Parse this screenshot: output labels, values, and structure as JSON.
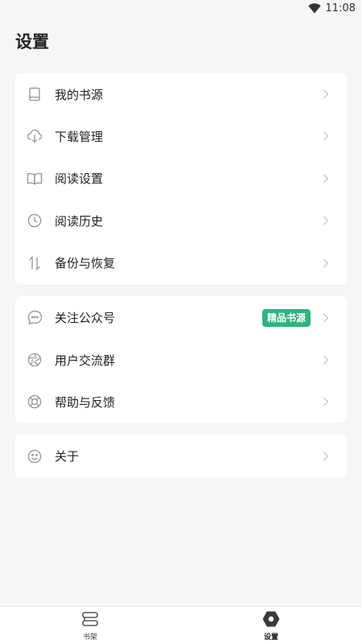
{
  "status_bar": {
    "time": "11:08"
  },
  "page": {
    "title": "设置"
  },
  "group1": [
    {
      "label": "我的书源",
      "icon": "book-icon"
    },
    {
      "label": "下载管理",
      "icon": "cloud-download-icon"
    },
    {
      "label": "阅读设置",
      "icon": "open-book-icon"
    },
    {
      "label": "阅读历史",
      "icon": "clock-icon"
    },
    {
      "label": "备份与恢复",
      "icon": "swap-vertical-icon"
    }
  ],
  "group2": [
    {
      "label": "关注公众号",
      "icon": "chat-bubble-icon",
      "badge": "精品书源"
    },
    {
      "label": "用户交流群",
      "icon": "aperture-icon"
    },
    {
      "label": "帮助与反馈",
      "icon": "lifebuoy-icon"
    }
  ],
  "group3": [
    {
      "label": "关于",
      "icon": "smiley-icon"
    }
  ],
  "bottom_nav": [
    {
      "label": "书架",
      "icon": "bookshelf-icon",
      "active": false
    },
    {
      "label": "设置",
      "icon": "settings-hex-icon",
      "active": true
    }
  ],
  "colors": {
    "accent": "#2db47c",
    "icon_gray": "#9a9a9a",
    "background": "#f6f6f6"
  }
}
